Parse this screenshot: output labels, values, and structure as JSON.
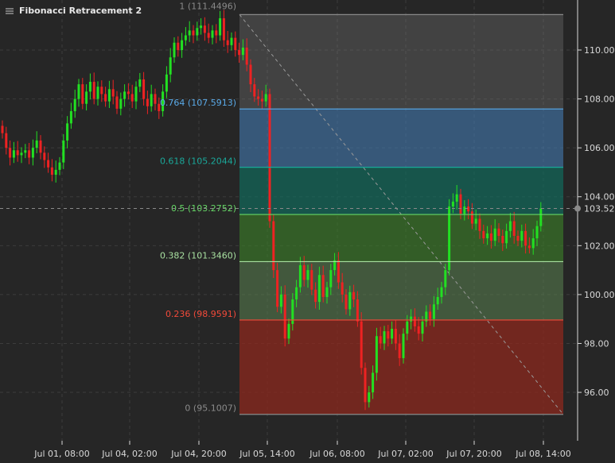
{
  "legend": {
    "title": "Fibonacci Retracement 2",
    "icon": "layers-icon"
  },
  "chart_data": {
    "type": "candlestick",
    "title": "Fibonacci Retracement 2",
    "interval": "1 hour",
    "x_tick_labels": [
      "Jul 01, 08:00",
      "Jul 04, 02:00",
      "Jul 04, 20:00",
      "Jul 05, 14:00",
      "Jul 06, 08:00",
      "Jul 07, 02:00",
      "Jul 07, 20:00",
      "Jul 08, 14:00"
    ],
    "y_ticks": [
      96,
      98,
      100,
      102,
      104,
      106,
      108,
      110
    ],
    "y_tick_labels": [
      "96.00",
      "98.00",
      "100.00",
      "102.00",
      "104.00",
      "106.00",
      "108.00",
      "110.00"
    ],
    "ylim": [
      94.3,
      112.0
    ],
    "current_price": 103.52,
    "current_price_label": "103.52",
    "grid": true,
    "colors": {
      "up": "#22e022",
      "down": "#ee2222",
      "background": "#262626",
      "text": "#d8d8d8"
    },
    "closes": [
      106.6,
      106.0,
      105.6,
      105.9,
      105.7,
      105.8,
      105.9,
      105.6,
      106.0,
      106.3,
      105.8,
      105.5,
      105.2,
      104.9,
      105.1,
      105.4,
      106.3,
      107.0,
      107.5,
      108.0,
      108.6,
      107.8,
      108.3,
      108.7,
      108.0,
      108.5,
      108.2,
      107.9,
      108.4,
      108.1,
      107.6,
      108.0,
      108.3,
      108.2,
      107.9,
      108.5,
      108.8,
      108.0,
      107.7,
      108.2,
      107.8,
      107.5,
      108.3,
      109.0,
      109.7,
      110.3,
      110.0,
      110.4,
      110.6,
      110.8,
      110.6,
      110.9,
      111.0,
      110.7,
      110.5,
      110.8,
      110.6,
      111.3,
      110.4,
      110.2,
      110.5,
      110.0,
      109.8,
      110.1,
      109.4,
      108.6,
      108.1,
      108.0,
      107.9,
      108.2,
      103.0,
      101.0,
      99.5,
      100.0,
      98.2,
      98.8,
      99.8,
      100.3,
      101.2,
      100.6,
      101.0,
      100.2,
      99.7,
      100.8,
      99.9,
      100.3,
      101.0,
      101.4,
      100.5,
      100.0,
      99.4,
      100.1,
      99.8,
      98.9,
      97.0,
      95.6,
      96.0,
      96.8,
      98.3,
      98.0,
      98.5,
      98.2,
      98.6,
      98.0,
      97.4,
      98.4,
      98.9,
      99.1,
      98.7,
      98.4,
      98.9,
      99.3,
      99.0,
      99.6,
      99.9,
      100.3,
      101.0,
      103.6,
      103.8,
      104.1,
      103.3,
      103.6,
      103.4,
      102.9,
      103.1,
      102.6,
      102.3,
      102.5,
      102.2,
      102.7,
      102.4,
      102.1,
      102.6,
      103.0,
      102.4,
      102.2,
      102.6,
      102.0,
      101.9,
      102.3,
      102.8,
      103.52
    ],
    "fibonacci": {
      "high": 111.4496,
      "low": 95.1007,
      "levels": [
        {
          "ratio": 1,
          "price": 111.4496,
          "label": "1 (111.4496)",
          "color": "#8a8a8a",
          "fill": "rgba(120,120,120,0.35)"
        },
        {
          "ratio": 0.764,
          "price": 107.5913,
          "label": "0.764 (107.5913)",
          "color": "#5aaae8",
          "fill": "rgba(70,130,190,0.55)"
        },
        {
          "ratio": 0.618,
          "price": 105.2044,
          "label": "0.618 (105.2044)",
          "color": "#1aa89a",
          "fill": "rgba(15,110,95,0.65)"
        },
        {
          "ratio": 0.5,
          "price": 103.2752,
          "label": "0.5 (103.2752)",
          "color": "#66d866",
          "fill": "rgba(60,130,40,0.6)"
        },
        {
          "ratio": 0.382,
          "price": 101.346,
          "label": "0.382 (101.3460)",
          "color": "#a8e0a0",
          "fill": "rgba(90,130,80,0.55)"
        },
        {
          "ratio": 0.236,
          "price": 98.9591,
          "label": "0.236 (98.9591)",
          "color": "#f24a3a",
          "fill": "rgba(140,40,30,0.75)"
        },
        {
          "ratio": 0,
          "price": 95.1007,
          "label": "0 (95.1007)",
          "color": "#8a8a8a",
          "fill": null
        }
      ]
    }
  }
}
